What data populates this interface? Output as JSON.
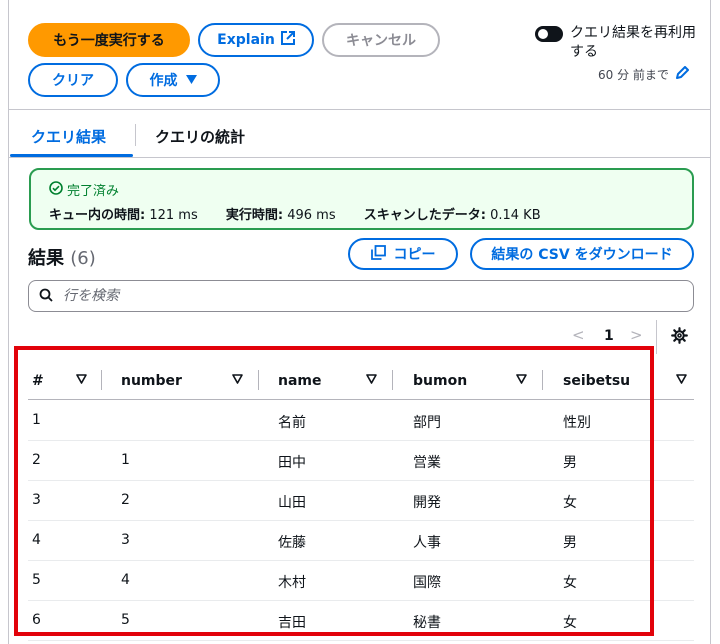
{
  "toolbar": {
    "rerun_label": "もう一度実行する",
    "explain_label": "Explain",
    "cancel_label": "キャンセル",
    "clear_label": "クリア",
    "create_label": "作成"
  },
  "reuse": {
    "label": "クエリ結果を再利用する",
    "sub": "60 分 前まで"
  },
  "tabs": [
    {
      "label": "クエリ結果",
      "active": true
    },
    {
      "label": "クエリの統計",
      "active": false
    }
  ],
  "status": {
    "text": "完了済み",
    "queue_label": "キュー内の時間:",
    "queue_value": "121 ms",
    "exec_label": "実行時間:",
    "exec_value": "496 ms",
    "scan_label": "スキャンしたデータ:",
    "scan_value": "0.14 KB"
  },
  "results": {
    "title": "結果",
    "count": "(6)",
    "copy_label": "コピー",
    "download_label": "結果の CSV をダウンロード",
    "search_placeholder": "行を検索"
  },
  "pagination": {
    "page": "1",
    "prev": "<",
    "next": ">"
  },
  "table": {
    "columns": [
      "#",
      "number",
      "name",
      "bumon",
      "seibetsu"
    ],
    "rows": [
      [
        "1",
        "",
        "名前",
        "部門",
        "性別"
      ],
      [
        "2",
        "1",
        "田中",
        "営業",
        "男"
      ],
      [
        "3",
        "2",
        "山田",
        "開発",
        "女"
      ],
      [
        "4",
        "3",
        "佐藤",
        "人事",
        "男"
      ],
      [
        "5",
        "4",
        "木村",
        "国際",
        "女"
      ],
      [
        "6",
        "5",
        "吉田",
        "秘書",
        "女"
      ]
    ]
  },
  "colors": {
    "accent": "#006ce0",
    "primary": "#ff9900",
    "success": "#00802f",
    "highlight": "#e2020a"
  }
}
